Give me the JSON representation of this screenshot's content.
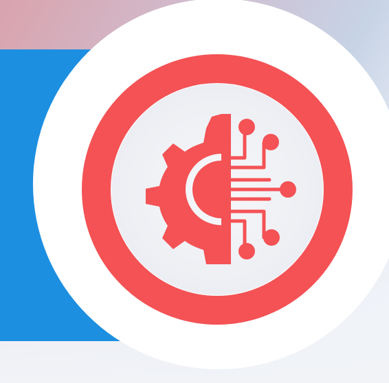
{
  "graphic": {
    "icon": "gear-circuit-icon",
    "description_icon_name": "ai-automation-icon"
  },
  "colors": {
    "accent_red": "#f45255",
    "blue_panel": "#1d8fe1",
    "white": "#ffffff",
    "inner_disc": "#f3f4f7"
  }
}
